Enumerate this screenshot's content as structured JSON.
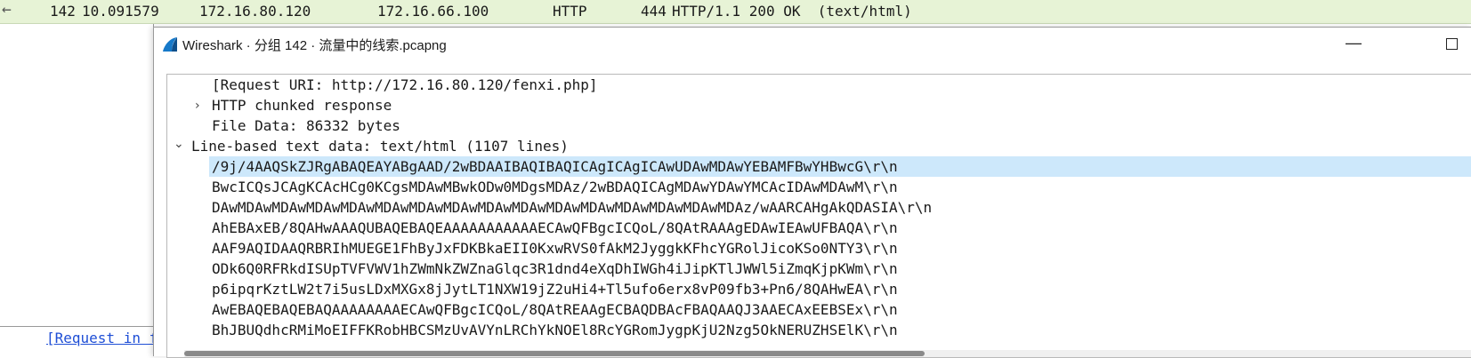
{
  "packet_row": {
    "no": "142",
    "time": "10.091579",
    "source": "172.16.80.120",
    "destination": "172.16.66.100",
    "protocol": "HTTP",
    "length": "444",
    "info": "HTTP/1.1 200 OK  (text/html)"
  },
  "background": {
    "link_text": "[Request in f"
  },
  "dialog": {
    "title": "Wireshark · 分组 142 · 流量中的线索.pcapng",
    "minimize_glyph": "—",
    "tree": {
      "request_uri": "[Request URI: http://172.16.80.120/fenxi.php]",
      "chunked": "HTTP chunked response",
      "file_data": "File Data: 86332 bytes",
      "line_based": "Line-based text data: text/html (1107 lines)"
    },
    "data_lines": [
      "/9j/4AAQSkZJRgABAQEAYABgAAD/2wBDAAIBAQIBAQICAgICAgICAwUDAwMDAwYEBAMFBwYHBwcG\\r\\n",
      "BwcICQsJCAgKCAcHCg0KCgsMDAwMBwkODw0MDgsMDAz/2wBDAQICAgMDAwYDAwYMCAcIDAwMDAwM\\r\\n",
      "DAwMDAwMDAwMDAwMDAwMDAwMDAwMDAwMDAwMDAwMDAwMDAwMDAwMDAwMDAwMDAz/wAARCAHgAkQDASIA\\r\\n",
      "AhEBAxEB/8QAHwAAAQUBAQEBAQEAAAAAAAAAAAECAwQFBgcICQoL/8QAtRAAAgEDAwIEAwUFBAQA\\r\\n",
      "AAF9AQIDAAQRBRIhMUEGE1FhByJxFDKBkaEII0KxwRVS0fAkM2JyggkKFhcYGRolJicoKSo0NTY3\\r\\n",
      "ODk6Q0RFRkdISUpTVFVWV1hZWmNkZWZnaGlqc3R1dnd4eXqDhIWGh4iJipKTlJWWl5iZmqKjpKWm\\r\\n",
      "p6ipqrKztLW2t7i5usLDxMXGx8jJytLT1NXW19jZ2uHi4+Tl5ufo6erx8vP09fb3+Pn6/8QAHwEA\\r\\n",
      "AwEBAQEBAQEBAQAAAAAAAAECAwQFBgcICQoL/8QAtREAAgECBAQDBAcFBAQAAQJ3AAECAxEEBSEx\\r\\n",
      "BhJBUQdhcRMiMoEIFFKRobHBCSMzUvAVYnLRChYkNOEl8RcYGRomJygpKjU2Nzg5OkNERUZHSElK\\r\\n"
    ]
  }
}
